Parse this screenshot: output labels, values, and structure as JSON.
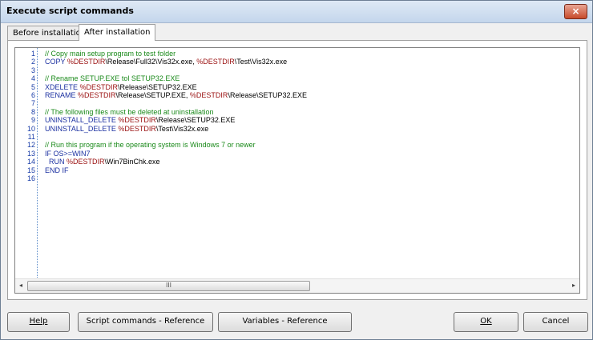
{
  "window": {
    "title": "Execute script commands",
    "close_glyph": "×"
  },
  "tabs": [
    {
      "label": "Before installation",
      "active": false
    },
    {
      "label": "After installation",
      "active": true
    }
  ],
  "editor": {
    "lines": [
      {
        "n": "1",
        "parts": [
          {
            "t": "// Copy main setup program to test folder",
            "k": "comment"
          }
        ]
      },
      {
        "n": "2",
        "parts": [
          {
            "t": "COPY ",
            "k": "kw"
          },
          {
            "t": "%DESTDIR",
            "k": "var"
          },
          {
            "t": "\\Release\\Full32\\Vis32x.exe, ",
            "k": "txt"
          },
          {
            "t": "%DESTDIR",
            "k": "var"
          },
          {
            "t": "\\Test\\Vis32x.exe",
            "k": "txt"
          }
        ]
      },
      {
        "n": "3",
        "parts": []
      },
      {
        "n": "4",
        "parts": [
          {
            "t": "// Rename SETUP.EXE tol SETUP32.EXE",
            "k": "comment"
          }
        ]
      },
      {
        "n": "5",
        "parts": [
          {
            "t": "XDELETE ",
            "k": "kw"
          },
          {
            "t": "%DESTDIR",
            "k": "var"
          },
          {
            "t": "\\Release\\SETUP32.EXE",
            "k": "txt"
          }
        ]
      },
      {
        "n": "6",
        "parts": [
          {
            "t": "RENAME ",
            "k": "kw"
          },
          {
            "t": "%DESTDIR",
            "k": "var"
          },
          {
            "t": "\\Release\\SETUP.EXE, ",
            "k": "txt"
          },
          {
            "t": "%DESTDIR",
            "k": "var"
          },
          {
            "t": "\\Release\\SETUP32.EXE",
            "k": "txt"
          }
        ]
      },
      {
        "n": "7",
        "parts": []
      },
      {
        "n": "8",
        "parts": [
          {
            "t": "// The following files must be deleted at uninstallation",
            "k": "comment"
          }
        ]
      },
      {
        "n": "9",
        "parts": [
          {
            "t": "UNINSTALL_DELETE ",
            "k": "kw"
          },
          {
            "t": "%DESTDIR",
            "k": "var"
          },
          {
            "t": "\\Release\\SETUP32.EXE",
            "k": "txt"
          }
        ]
      },
      {
        "n": "10",
        "parts": [
          {
            "t": "UNINSTALL_DELETE ",
            "k": "kw"
          },
          {
            "t": "%DESTDIR",
            "k": "var"
          },
          {
            "t": "\\Test\\Vis32x.exe",
            "k": "txt"
          }
        ]
      },
      {
        "n": "11",
        "parts": []
      },
      {
        "n": "12",
        "parts": [
          {
            "t": "// Run this program if the operating system is Windows 7 or newer",
            "k": "comment"
          }
        ]
      },
      {
        "n": "13",
        "parts": [
          {
            "t": "IF OS>=WIN7",
            "k": "kw"
          }
        ]
      },
      {
        "n": "14",
        "parts": [
          {
            "t": "  RUN ",
            "k": "kw"
          },
          {
            "t": "%DESTDIR",
            "k": "var"
          },
          {
            "t": "\\Win7BinChk.exe",
            "k": "txt"
          }
        ]
      },
      {
        "n": "15",
        "parts": [
          {
            "t": "END IF",
            "k": "kw"
          }
        ]
      },
      {
        "n": "16",
        "parts": []
      }
    ],
    "scroll_left": "◂",
    "scroll_right": "▸",
    "thumb_grip": "III"
  },
  "buttons": {
    "help": "Help",
    "script_ref": "Script commands - Reference",
    "variables_ref": "Variables - Reference",
    "ok": "OK",
    "cancel": "Cancel"
  },
  "colors": {
    "comment": "#1b8a1b",
    "keyword": "#1a2fa0",
    "variable": "#9a1010",
    "gutter_border": "#5a8ac8"
  }
}
